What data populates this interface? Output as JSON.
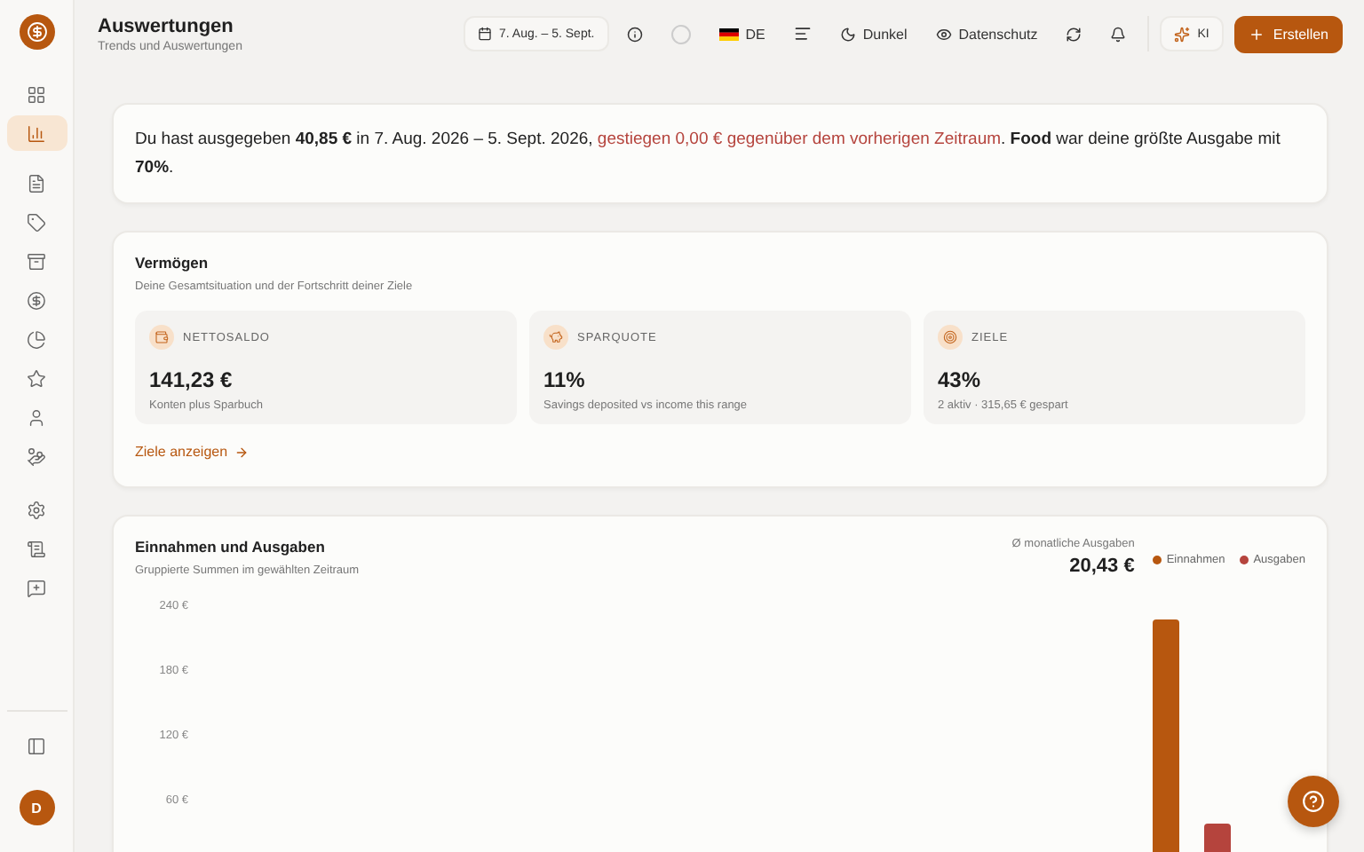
{
  "sidebar": {
    "items": [
      {
        "selected": false
      },
      {
        "selected": true
      },
      {
        "selected": false
      },
      {
        "selected": false
      },
      {
        "selected": false
      },
      {
        "selected": false
      },
      {
        "selected": false
      },
      {
        "selected": false
      },
      {
        "selected": false
      },
      {
        "selected": false
      },
      {
        "selected": false
      },
      {
        "selected": false
      },
      {
        "selected": false
      }
    ],
    "avatar": "D"
  },
  "header": {
    "title": "Auswertungen",
    "subtitle": "Trends und Auswertungen",
    "date_range": "7. Aug. – 5. Sept.",
    "language": "DE",
    "theme": "Dunkel",
    "privacy": "Datenschutz",
    "ai": "KI",
    "create": "Erstellen"
  },
  "summary": {
    "parts": [
      {
        "kind": "plain",
        "text": "Du hast ausgegeben **40,85 €** in 7. Aug. 2026 – 5. Sept. 2026, "
      },
      {
        "kind": "change",
        "text": "gestiegen 0,00 € gegenüber dem vorherigen Zeitraum"
      },
      {
        "kind": "plain",
        "text": ". **Food** war deine größte Ausgabe mit **70%**."
      }
    ]
  },
  "wealth": {
    "title": "Vermögen",
    "subtitle": "Deine Gesamtsituation und der Fortschritt deiner Ziele",
    "stats": [
      {
        "label": "NETTOSALDO",
        "value": "141,23 €",
        "note": "Konten plus Sparbuch"
      },
      {
        "label": "SPARQUOTE",
        "value": "11%",
        "note": "Savings deposited vs income this range"
      },
      {
        "label": "ZIELE",
        "value": "43%",
        "note": "2 aktiv · 315,65 € gespart"
      }
    ],
    "link": "Ziele anzeigen"
  },
  "income_expenses": {
    "title": "Einnahmen und Ausgaben",
    "subtitle": "Gruppierte Summen im gewählten Zeitraum",
    "average_label": "Ø monatliche Ausgaben",
    "average_value": "20,43 €",
    "legend": [
      {
        "name": "Einnahmen",
        "color": "#b7570f"
      },
      {
        "name": "Ausgaben",
        "color": "#b5443d"
      }
    ],
    "axis_labels": [
      "240 €",
      "180 €",
      "120 €",
      "60 €"
    ]
  }
}
